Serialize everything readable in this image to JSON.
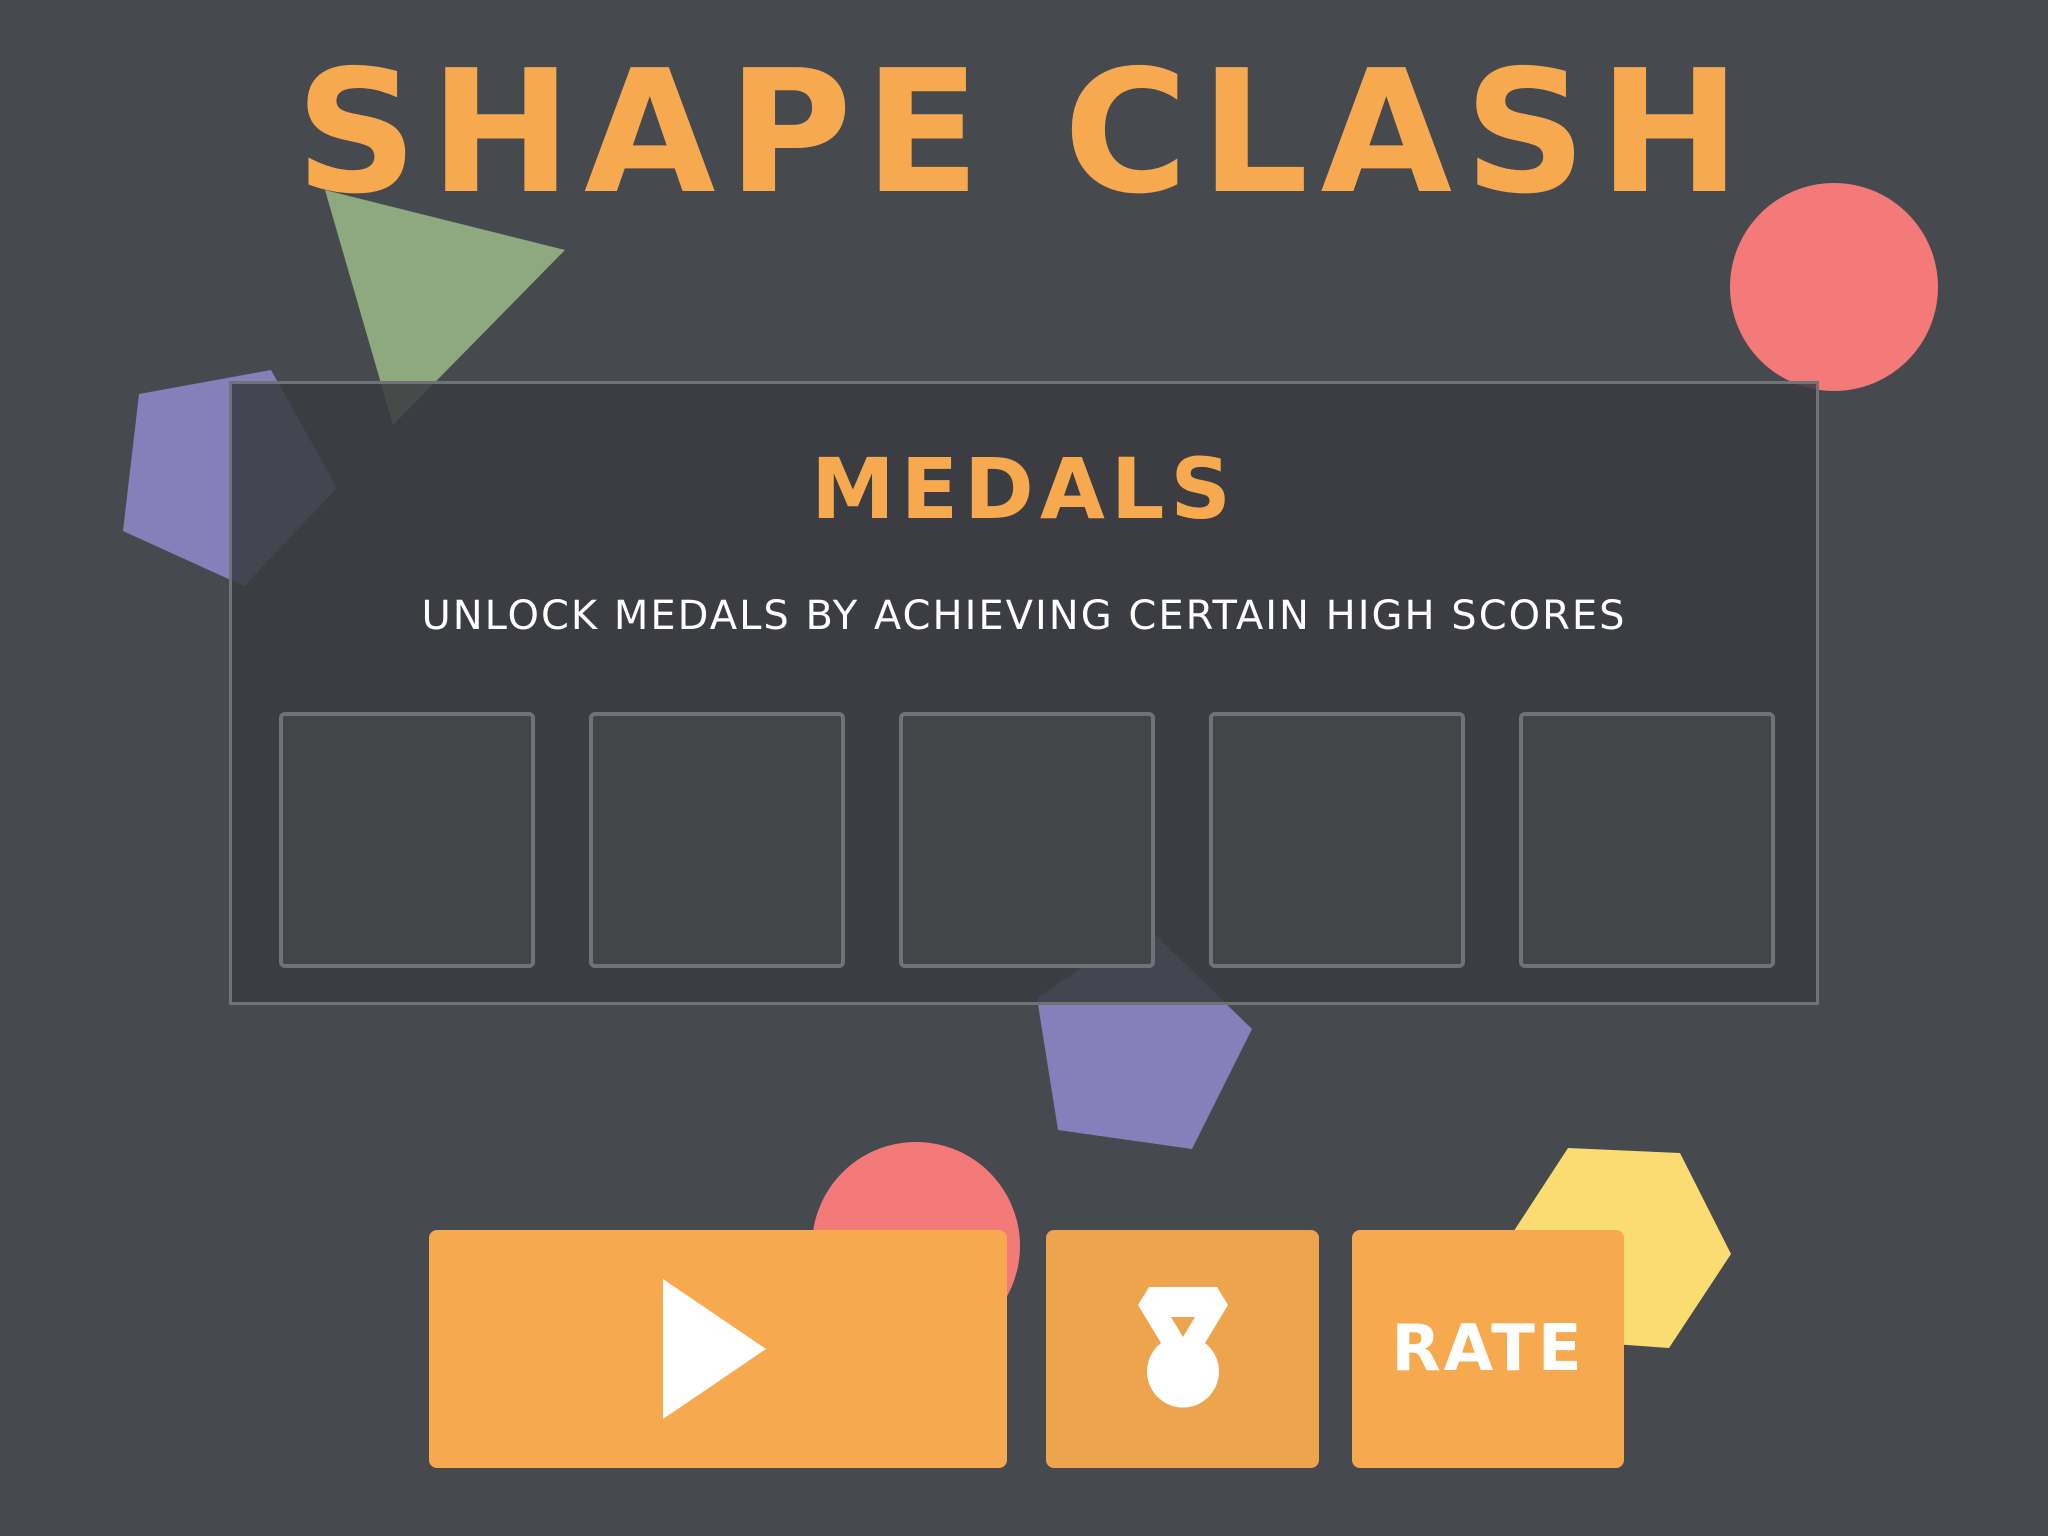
{
  "game": {
    "title": "SHAPE CLASH"
  },
  "medals_panel": {
    "title": "MEDALS",
    "subtitle": "UNLOCK MEDALS BY ACHIEVING CERTAIN HIGH SCORES",
    "slots": [
      {
        "unlocked": false
      },
      {
        "unlocked": false
      },
      {
        "unlocked": false
      },
      {
        "unlocked": false
      },
      {
        "unlocked": false
      }
    ]
  },
  "buttons": {
    "play": {
      "icon": "play-icon"
    },
    "medals": {
      "icon": "medal-icon"
    },
    "rate": {
      "label": "RATE"
    }
  },
  "colors": {
    "background": "#464a4f",
    "accent_orange": "#f7a94f",
    "shape_green": "#8ea97e",
    "shape_purple": "#8580ba",
    "shape_red": "#f47a79",
    "shape_yellow": "#fbdc72"
  }
}
